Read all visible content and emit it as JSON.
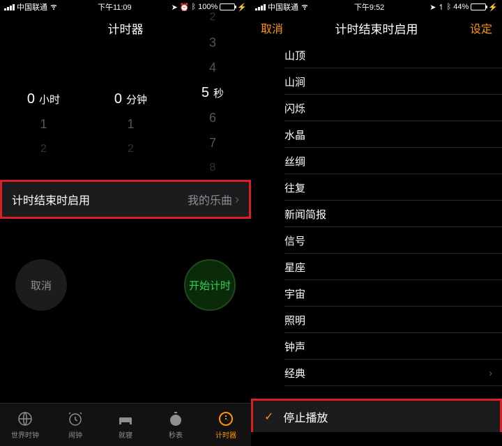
{
  "left": {
    "status": {
      "carrier": "中国联通",
      "time": "下午11:09",
      "battery_pct": "100%",
      "battery_fill": "100%"
    },
    "title": "计时器",
    "picker": {
      "hours_label": "小时",
      "mins_label": "分钟",
      "secs_label": "秒",
      "hours": [
        "",
        "0",
        "1",
        "2"
      ],
      "mins": [
        "",
        "0",
        "1",
        "2"
      ],
      "secs": [
        "2",
        "3",
        "4",
        "5",
        "6",
        "7",
        "8"
      ]
    },
    "setting": {
      "label": "计时结束时启用",
      "value": "我的乐曲"
    },
    "buttons": {
      "cancel": "取消",
      "start": "开始计时"
    },
    "tabs": [
      {
        "label": "世界时钟"
      },
      {
        "label": "闹钟"
      },
      {
        "label": "就寝"
      },
      {
        "label": "秒表"
      },
      {
        "label": "计时器"
      }
    ]
  },
  "right": {
    "status": {
      "carrier": "中国联通",
      "time": "下午9:52",
      "battery_pct": "44%",
      "battery_fill": "44%"
    },
    "nav": {
      "cancel": "取消",
      "title": "计时结束时启用",
      "set": "设定"
    },
    "sounds": [
      "山顶",
      "山涧",
      "闪烁",
      "水晶",
      "丝绸",
      "往复",
      "新闻简报",
      "信号",
      "星座",
      "宇宙",
      "照明",
      "钟声",
      "经典"
    ],
    "stop": "停止播放"
  }
}
